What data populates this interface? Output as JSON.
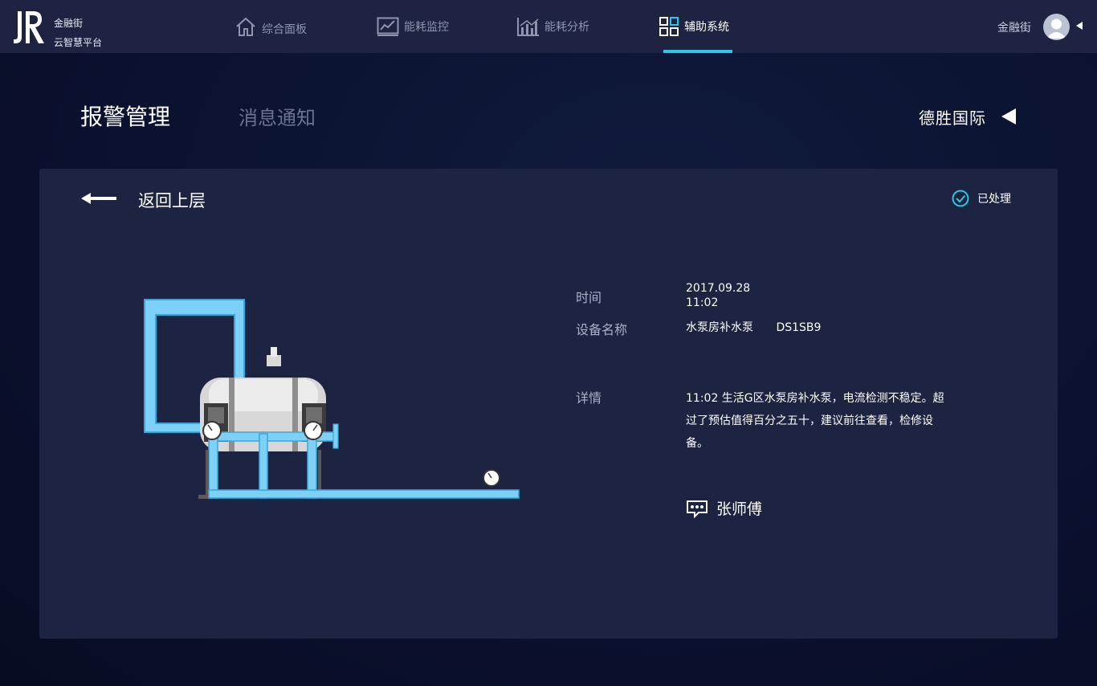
{
  "brand": {
    "line1": "金融街",
    "line2": "云智慧平台"
  },
  "nav": [
    {
      "label": "综合面板",
      "icon": "home-icon"
    },
    {
      "label": "能耗监控",
      "icon": "line-chart-icon"
    },
    {
      "label": "能耗分析",
      "icon": "bar-chart-icon"
    },
    {
      "label": "辅助系统",
      "icon": "grid-icon",
      "active": true
    }
  ],
  "user": {
    "name": "金融街"
  },
  "page": {
    "tabs": [
      "报警管理",
      "消息通知"
    ],
    "building": "德胜国际"
  },
  "card": {
    "back_label": "返回上层",
    "status": "已处理",
    "fields": {
      "time_label": "时间",
      "time_date": "2017.09.28",
      "time_clock": "11:02",
      "device_label": "设备名称",
      "device_name": "水泵房补水泵",
      "device_code": "DS1SB9",
      "detail_label": "详情",
      "detail_text": "11:02 生活G区水泵房补水泵，电流检测不稳定。超过了预估值得百分之五十，建议前往查看，检修设备。"
    },
    "assignee": "张师傅"
  },
  "colors": {
    "accent": "#29c8e6",
    "pipe": "#7dd1f7",
    "card_bg": "#1d2441",
    "topbar_bg": "#1d2340"
  }
}
